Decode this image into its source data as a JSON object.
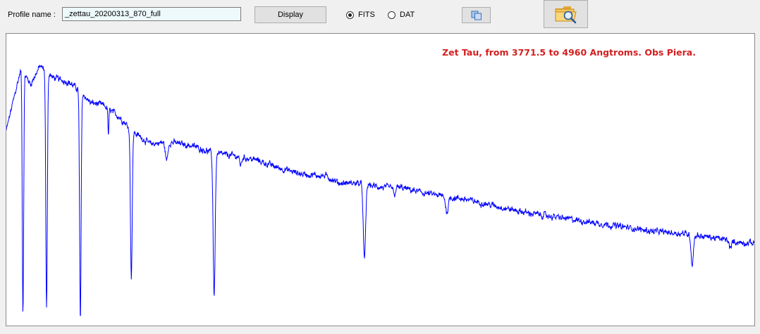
{
  "toolbar": {
    "profile_label": "Profile name :",
    "profile_value": "_zettau_20200313_870_full",
    "display_label": "Display",
    "format_options": [
      {
        "label": "FITS",
        "selected": true
      },
      {
        "label": "DAT",
        "selected": false
      }
    ],
    "copy_icon": "copy-icon",
    "open_icon": "folder-search-icon"
  },
  "chart_data": {
    "type": "line",
    "title": "Zet Tau, from 3771.5 to 4960 Angtroms. Obs Piera.",
    "xlabel": "",
    "ylabel": "",
    "xlim": [
      3771.5,
      4960
    ],
    "ylim": [
      0,
      1.27
    ],
    "grid": false,
    "line_color": "#0000ff",
    "title_color": "#d41f1f",
    "series": [
      {
        "continuum": [
          [
            3771.5,
            0.85
          ],
          [
            3780,
            0.95
          ],
          [
            3795,
            1.12
          ],
          [
            3810,
            1.05
          ],
          [
            3825,
            1.13
          ],
          [
            3845,
            1.08
          ],
          [
            3870,
            1.06
          ],
          [
            3885,
            1.03
          ],
          [
            3905,
            0.97
          ],
          [
            3925,
            0.96
          ],
          [
            3950,
            0.91
          ],
          [
            3975,
            0.84
          ],
          [
            4000,
            0.79
          ],
          [
            4030,
            0.8
          ],
          [
            4070,
            0.78
          ],
          [
            4100,
            0.75
          ],
          [
            4130,
            0.74
          ],
          [
            4170,
            0.72
          ],
          [
            4200,
            0.69
          ],
          [
            4240,
            0.66
          ],
          [
            4280,
            0.65
          ],
          [
            4300,
            0.62
          ],
          [
            4330,
            0.62
          ],
          [
            4370,
            0.6
          ],
          [
            4400,
            0.6
          ],
          [
            4430,
            0.58
          ],
          [
            4470,
            0.56
          ],
          [
            4500,
            0.55
          ],
          [
            4550,
            0.52
          ],
          [
            4600,
            0.49
          ],
          [
            4650,
            0.47
          ],
          [
            4700,
            0.45
          ],
          [
            4750,
            0.43
          ],
          [
            4800,
            0.41
          ],
          [
            4850,
            0.4
          ],
          [
            4900,
            0.38
          ],
          [
            4940,
            0.36
          ],
          [
            4960,
            0.36
          ]
        ],
        "absorption_lines": [
          {
            "wavelength": 3797.9,
            "depth": 0.95,
            "width": 1.1
          },
          {
            "wavelength": 3835.4,
            "depth": 0.94,
            "width": 1.2
          },
          {
            "wavelength": 3889.1,
            "depth": 0.98,
            "width": 1.2
          },
          {
            "wavelength": 3970.1,
            "depth": 0.75,
            "width": 1.4
          },
          {
            "wavelength": 4101.7,
            "depth": 0.82,
            "width": 1.6
          },
          {
            "wavelength": 4340.5,
            "depth": 0.54,
            "width": 1.8
          },
          {
            "wavelength": 4861.3,
            "depth": 0.33,
            "width": 1.8
          },
          {
            "wavelength": 4921.9,
            "depth": 0.1,
            "width": 1.6
          },
          {
            "wavelength": 4471.5,
            "depth": 0.12,
            "width": 2.0
          },
          {
            "wavelength": 4026.2,
            "depth": 0.1,
            "width": 2.0
          },
          {
            "wavelength": 3933.7,
            "depth": 0.12,
            "width": 0.8
          },
          {
            "wavelength": 4387.9,
            "depth": 0.06,
            "width": 1.5
          },
          {
            "wavelength": 4143.8,
            "depth": 0.05,
            "width": 1.5
          }
        ]
      }
    ]
  }
}
